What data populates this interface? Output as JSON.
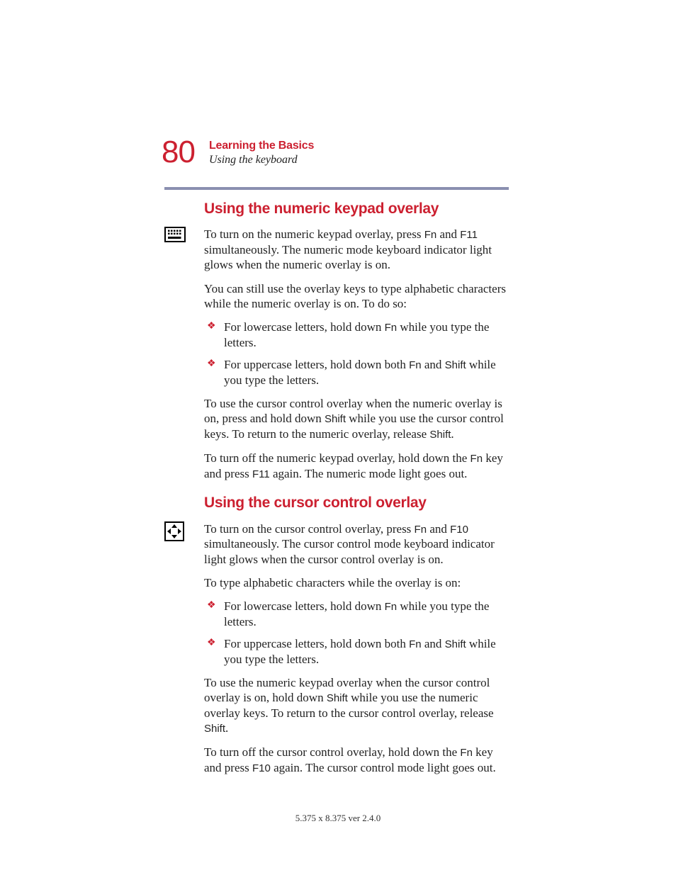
{
  "page_number": "80",
  "chapter": "Learning the Basics",
  "section": "Using the keyboard",
  "s1": {
    "heading": "Using the numeric keypad overlay",
    "p1a": "To turn on the numeric keypad overlay, press ",
    "p1_key1": "Fn",
    "p1b": " and ",
    "p1_key2": "F11",
    "p1c": " simultaneously. The numeric mode keyboard indicator light glows when the numeric overlay is on.",
    "p2": "You can still use the overlay keys to type alphabetic characters while the numeric overlay is on. To do so:",
    "li1a": "For lowercase letters, hold down ",
    "li1_key": "Fn",
    "li1b": " while you type the letters.",
    "li2a": "For uppercase letters, hold down both ",
    "li2_key1": "Fn",
    "li2b": " and ",
    "li2_key2": "Shift",
    "li2c": " while you type the letters.",
    "p3a": "To use the cursor control overlay when the numeric overlay is on, press and hold down ",
    "p3_key1": "Shift",
    "p3b": " while you use the cursor control keys. To return to the numeric overlay, release ",
    "p3_key2": "Shift",
    "p3c": ".",
    "p4a": "To turn off the numeric keypad overlay, hold down the ",
    "p4_key1": "Fn",
    "p4b": " key and press ",
    "p4_key2": "F11",
    "p4c": " again. The numeric mode light goes out."
  },
  "s2": {
    "heading": "Using the cursor control overlay",
    "p1a": "To turn on the cursor control overlay, press ",
    "p1_key1": "Fn",
    "p1b": " and ",
    "p1_key2": "F10",
    "p1c": " simultaneously. The cursor control mode keyboard indicator light glows when the cursor control overlay is on.",
    "p2": "To type alphabetic characters while the overlay is on:",
    "li1a": "For lowercase letters, hold down ",
    "li1_key": "Fn",
    "li1b": " while you type the letters.",
    "li2a": "For uppercase letters, hold down both ",
    "li2_key1": "Fn",
    "li2b": " and ",
    "li2_key2": "Shift",
    "li2c": " while you type the letters.",
    "p3a": "To use the numeric keypad overlay when the cursor control overlay is on, hold down ",
    "p3_key1": "Shift",
    "p3b": " while you use the numeric overlay keys. To return to the cursor control overlay, release ",
    "p3_key2": "Shift",
    "p3c": ".",
    "p4a": "To turn off the cursor control overlay, hold down the ",
    "p4_key1": "Fn",
    "p4b": " key and press ",
    "p4_key2": "F10",
    "p4c": " again. The cursor control mode light goes out."
  },
  "footer": "5.375 x 8.375 ver 2.4.0"
}
